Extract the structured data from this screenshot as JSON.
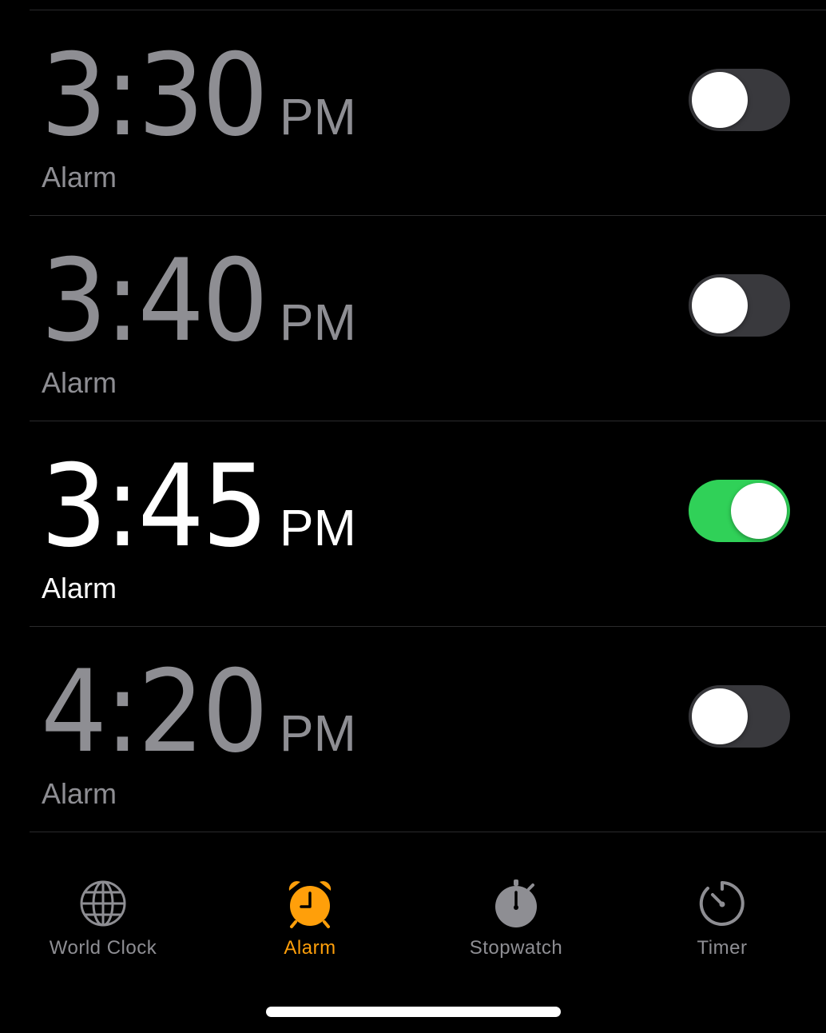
{
  "alarms": [
    {
      "time": "3:30",
      "ampm": "PM",
      "label": "Alarm",
      "enabled": false
    },
    {
      "time": "3:40",
      "ampm": "PM",
      "label": "Alarm",
      "enabled": false
    },
    {
      "time": "3:45",
      "ampm": "PM",
      "label": "Alarm",
      "enabled": true
    },
    {
      "time": "4:20",
      "ampm": "PM",
      "label": "Alarm",
      "enabled": false
    }
  ],
  "tab_bar": {
    "tabs": [
      {
        "label": "World Clock",
        "icon": "globe-icon",
        "active": false
      },
      {
        "label": "Alarm",
        "icon": "alarm-clock-icon",
        "active": true
      },
      {
        "label": "Stopwatch",
        "icon": "stopwatch-icon",
        "active": false
      },
      {
        "label": "Timer",
        "icon": "timer-icon",
        "active": false
      }
    ]
  },
  "colors": {
    "background": "#000000",
    "text_on": "#ffffff",
    "text_off": "#8e8e93",
    "toggle_on": "#30d158",
    "toggle_off": "#39393d",
    "accent": "#ff9f0a"
  }
}
